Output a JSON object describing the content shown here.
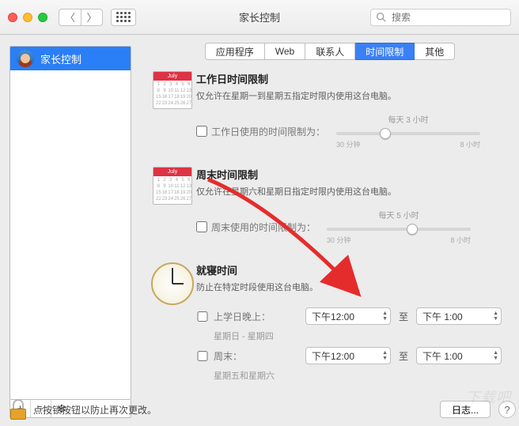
{
  "window": {
    "title": "家长控制"
  },
  "search": {
    "placeholder": "搜索"
  },
  "sidebar": {
    "items": [
      {
        "label": "家长控制"
      }
    ],
    "add": "+",
    "remove": "−",
    "gear": "✻"
  },
  "tabs": [
    {
      "label": "应用程序"
    },
    {
      "label": "Web"
    },
    {
      "label": "联系人"
    },
    {
      "label": "时间限制",
      "selected": true
    },
    {
      "label": "其他"
    }
  ],
  "weekday": {
    "title": "工作日时间限制",
    "desc": "仅允许在星期一到星期五指定时限内使用这台电脑。",
    "check_label": "工作日使用的时间限制为：",
    "slider_top": "每天 3 小时",
    "slider_min": "30 分钟",
    "slider_max": "8 小时"
  },
  "weekend": {
    "title": "周末时间限制",
    "desc": "仅允许在星期六和星期日指定时限内使用这台电脑。",
    "check_label": "周末使用的时间限制为：",
    "slider_top": "每天 5 小时",
    "slider_min": "30 分钟",
    "slider_max": "8 小时"
  },
  "bedtime": {
    "title": "就寝时间",
    "desc": "防止在特定时段使用这台电脑。",
    "rows": [
      {
        "label": "上学日晚上：",
        "sub": "星期日 - 星期四",
        "from": "下午12:00",
        "to_label": "至",
        "to": "下午  1:00"
      },
      {
        "label": "周末：",
        "sub": "星期五和星期六",
        "from": "下午12:00",
        "to_label": "至",
        "to": "下午  1:00"
      }
    ]
  },
  "footer": {
    "lock_text": "点按锁按钮以防止再次更改。",
    "log_btn": "日志...",
    "help": "?"
  },
  "calendar_header": "July",
  "watermark": "下载吧"
}
